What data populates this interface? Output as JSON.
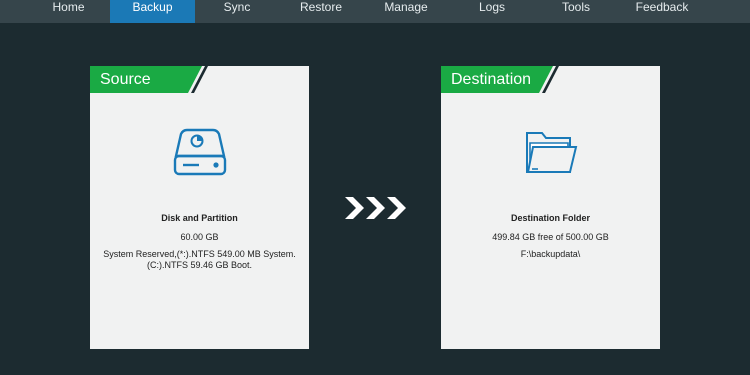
{
  "nav": {
    "items": [
      {
        "label": "Home"
      },
      {
        "label": "Backup"
      },
      {
        "label": "Sync"
      },
      {
        "label": "Restore"
      },
      {
        "label": "Manage"
      },
      {
        "label": "Logs"
      },
      {
        "label": "Tools"
      },
      {
        "label": "Feedback"
      }
    ],
    "active": "Backup"
  },
  "source": {
    "title": "Source",
    "icon": "disk-icon",
    "heading": "Disk and Partition",
    "size": "60.00 GB",
    "details_line1": "System Reserved,(*:).NTFS 549.00 MB System.",
    "details_line2": "(C:).NTFS 59.46 GB Boot."
  },
  "destination": {
    "title": "Destination",
    "icon": "folder-icon",
    "heading": "Destination Folder",
    "space": "499.84 GB free of 500.00 GB",
    "path": "F:\\backupdata\\"
  },
  "arrow_icon": "triple-chevron-right-icon",
  "colors": {
    "background": "#1c2b30",
    "nav_background": "#36454b",
    "nav_active": "#1b79b6",
    "header_green": "#1aaa44",
    "card_background": "#f1f2f2",
    "icon_blue": "#1a7ab8"
  }
}
